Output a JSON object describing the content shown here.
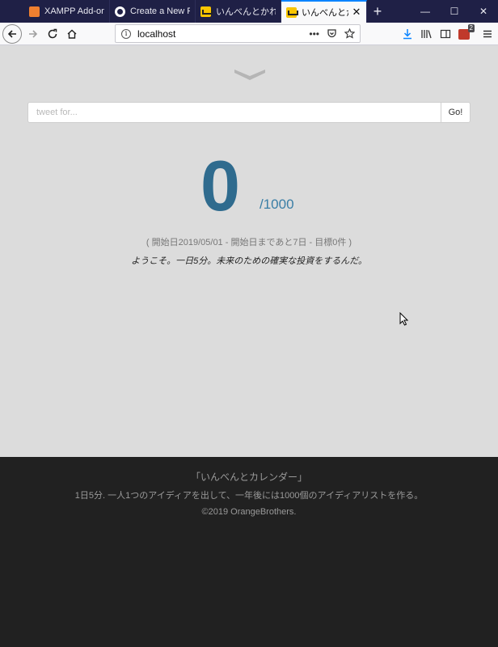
{
  "browser": {
    "tabs": [
      {
        "title": "XAMPP Add-ons",
        "icon": "xampp-icon"
      },
      {
        "title": "Create a New Repo",
        "icon": "github-icon"
      },
      {
        "title": "いんべんとかれんだー",
        "icon": "app-favicon"
      },
      {
        "title": "いんべんとかれんだー",
        "icon": "app-favicon",
        "active": true,
        "close": "✕"
      }
    ],
    "new_tab": "+",
    "window_controls": {
      "minimize": "—",
      "maximize": "☐",
      "close": "✕"
    },
    "url": "localhost",
    "url_actions": {
      "more": "•••"
    },
    "extension_badge": "2"
  },
  "page": {
    "tweet_placeholder": "tweet for...",
    "tweet_value": "",
    "go_label": "Go!",
    "count": "0",
    "goal": "/1000",
    "info": "( 開始日2019/05/01 - 開始日まであと7日 - 目標0件 )",
    "welcome": "ようこそ。一日5分。未来のための確実な投資をするんだ。"
  },
  "footer": {
    "title": "「いんべんとカレンダー」",
    "description": "1日5分. 一人1つのアイディアを出して、一年後には1000個のアイディアリストを作る。",
    "copyright": "©2019 OrangeBrothers."
  },
  "colors": {
    "tabbar": "#1f2046",
    "content_bg": "#dcdcdc",
    "counter": "#2f6b8e",
    "footer_bg": "#212121"
  }
}
